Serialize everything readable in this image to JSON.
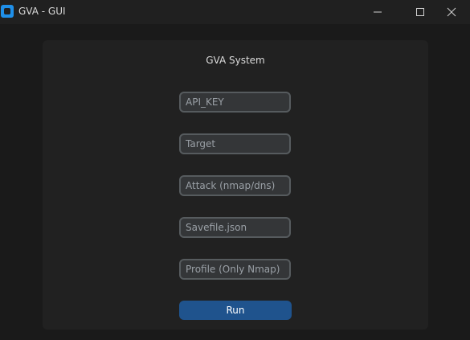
{
  "window": {
    "title": "GVA - GUI",
    "icon": "app-icon",
    "controls": {
      "minimize_icon": "minimize-icon",
      "maximize_icon": "maximize-icon",
      "close_icon": "close-icon"
    }
  },
  "main": {
    "heading": "GVA System",
    "fields": {
      "api_key": {
        "placeholder": "API_KEY",
        "value": ""
      },
      "target": {
        "placeholder": "Target",
        "value": ""
      },
      "attack": {
        "placeholder": "Attack (nmap/dns)",
        "value": ""
      },
      "savefile": {
        "placeholder": "Savefile.json",
        "value": ""
      },
      "profile": {
        "placeholder": "Profile (Only Nmap)",
        "value": ""
      }
    },
    "run_label": "Run"
  },
  "colors": {
    "background": "#1a1a1a",
    "titlebar": "#202020",
    "frame": "#212121",
    "entry_bg": "#343638",
    "entry_border": "#565b5e",
    "accent": "#1f538d",
    "app_icon": "#1f8fe8"
  }
}
